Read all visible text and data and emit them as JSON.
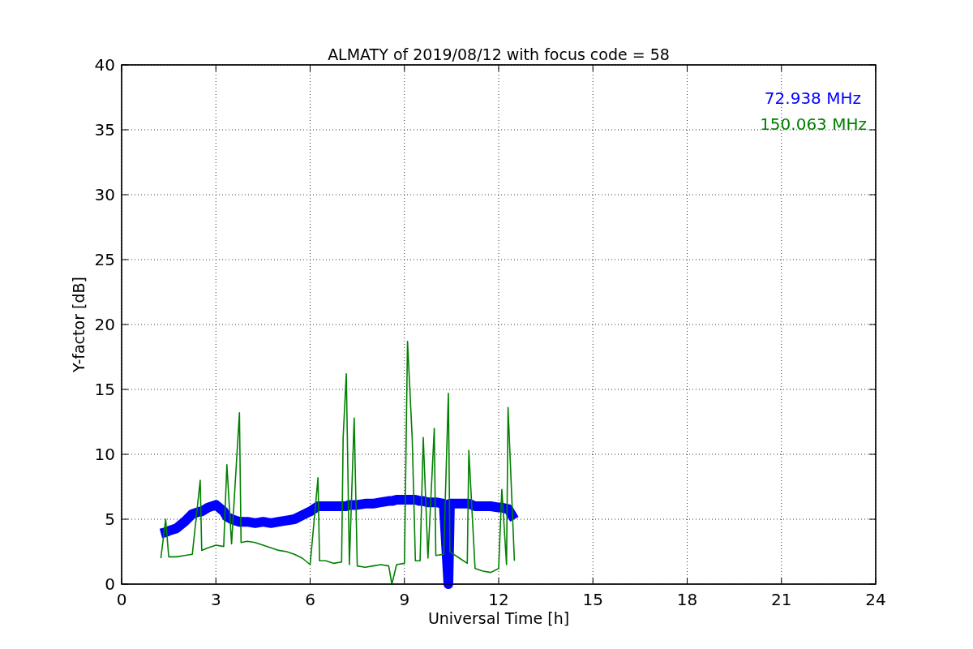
{
  "chart_data": {
    "type": "line",
    "title": "ALMATY of 2019/08/12 with focus code = 58",
    "xlabel": "Universal Time [h]",
    "ylabel": "Y-factor [dB]",
    "x": [
      1.25,
      1.4,
      1.5,
      1.75,
      2,
      2.25,
      2.5,
      2.55,
      2.75,
      3,
      3.25,
      3.35,
      3.5,
      3.75,
      3.8,
      4,
      4.25,
      4.5,
      4.75,
      5,
      5.25,
      5.5,
      5.75,
      6,
      6.25,
      6.3,
      6.5,
      6.75,
      7,
      7.05,
      7.15,
      7.25,
      7.4,
      7.5,
      7.75,
      8,
      8.25,
      8.5,
      8.6,
      8.75,
      9,
      9.1,
      9.25,
      9.35,
      9.5,
      9.6,
      9.75,
      9.95,
      10,
      10.25,
      10.4,
      10.45,
      10.5,
      10.75,
      11,
      11.05,
      11.25,
      11.5,
      11.75,
      12,
      12.1,
      12.25,
      12.3,
      12.5
    ],
    "series": [
      {
        "name": "72.938 MHz",
        "color": "#0000ff",
        "values": [
          3.9,
          4.0,
          4.1,
          4.3,
          4.8,
          5.4,
          5.6,
          5.6,
          5.9,
          6.1,
          5.6,
          5.2,
          5.0,
          4.8,
          4.8,
          4.8,
          4.7,
          4.8,
          4.7,
          4.8,
          4.9,
          5.0,
          5.3,
          5.6,
          6.0,
          6.0,
          6.0,
          6.0,
          6.0,
          6.0,
          6.0,
          6.1,
          6.1,
          6.1,
          6.2,
          6.2,
          6.3,
          6.4,
          6.4,
          6.5,
          6.5,
          6.5,
          6.5,
          6.5,
          6.4,
          6.4,
          6.3,
          6.3,
          6.3,
          6.2,
          0,
          6.2,
          6.2,
          6.2,
          6.2,
          6.2,
          6.0,
          6.0,
          6.0,
          5.9,
          5.9,
          5.8,
          5.8,
          5.0
        ]
      },
      {
        "name": "150.063 MHz",
        "color": "#008000",
        "values": [
          2.0,
          5.0,
          2.1,
          2.1,
          2.2,
          2.3,
          8.0,
          2.6,
          2.8,
          3.0,
          2.9,
          9.2,
          3.1,
          13.2,
          3.2,
          3.3,
          3.2,
          3.0,
          2.8,
          2.6,
          2.5,
          2.3,
          2.0,
          1.5,
          8.2,
          1.8,
          1.8,
          1.6,
          1.7,
          11.3,
          16.2,
          1.5,
          12.8,
          1.4,
          1.3,
          1.4,
          1.5,
          1.4,
          0,
          1.5,
          1.6,
          18.7,
          11.2,
          1.8,
          1.8,
          11.3,
          2.0,
          12.0,
          2.2,
          2.3,
          14.7,
          2.5,
          2.4,
          2.0,
          1.6,
          10.3,
          1.2,
          1.0,
          0.9,
          1.2,
          7.3,
          1.5,
          13.6,
          1.8
        ]
      }
    ],
    "grid": true,
    "xlim": [
      0,
      24
    ],
    "ylim": [
      0,
      40
    ],
    "xticks": [
      0,
      3,
      6,
      9,
      12,
      15,
      18,
      21,
      24
    ],
    "yticks": [
      0,
      5,
      10,
      15,
      20,
      25,
      30,
      35,
      40
    ]
  }
}
